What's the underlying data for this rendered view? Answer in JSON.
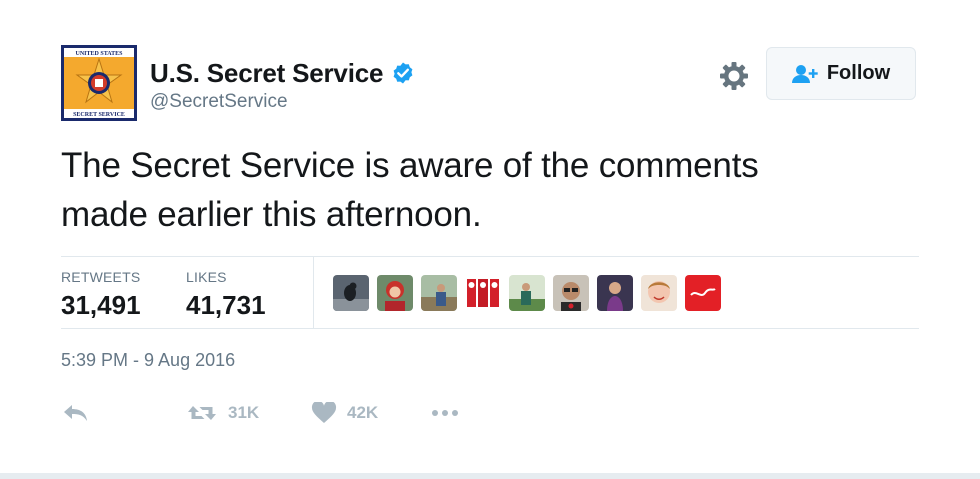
{
  "tweet": {
    "display_name": "U.S. Secret Service",
    "handle": "@SecretService",
    "text_line1": "The Secret Service is aware of the comments",
    "text_line2": "made earlier this afternoon.",
    "timestamp": "5:39 PM - 9 Aug 2016",
    "verified": true,
    "avatar_badge_top": "UNITED STATES",
    "avatar_badge_bottom": "SECRET SERVICE"
  },
  "follow": {
    "label": "Follow"
  },
  "stats": {
    "retweets_label": "RETWEETS",
    "retweets_value": "31,491",
    "likes_label": "LIKES",
    "likes_value": "41,731"
  },
  "actions": {
    "retweet_count": "31K",
    "like_count": "42K"
  },
  "likers": [
    {
      "icon": "avatar-bird"
    },
    {
      "icon": "avatar-woman-red-hair"
    },
    {
      "icon": "avatar-outdoor-person"
    },
    {
      "icon": "avatar-red-figures"
    },
    {
      "icon": "avatar-green-figure"
    },
    {
      "icon": "avatar-man-glasses"
    },
    {
      "icon": "avatar-woman-purple"
    },
    {
      "icon": "avatar-woman-smiling"
    },
    {
      "icon": "avatar-red-logo"
    }
  ],
  "colors": {
    "verified_blue": "#1da1f2",
    "text_dark": "#14171a",
    "text_grey": "#657786",
    "action_grey": "#aab8c2",
    "border": "#e1e8ed"
  }
}
